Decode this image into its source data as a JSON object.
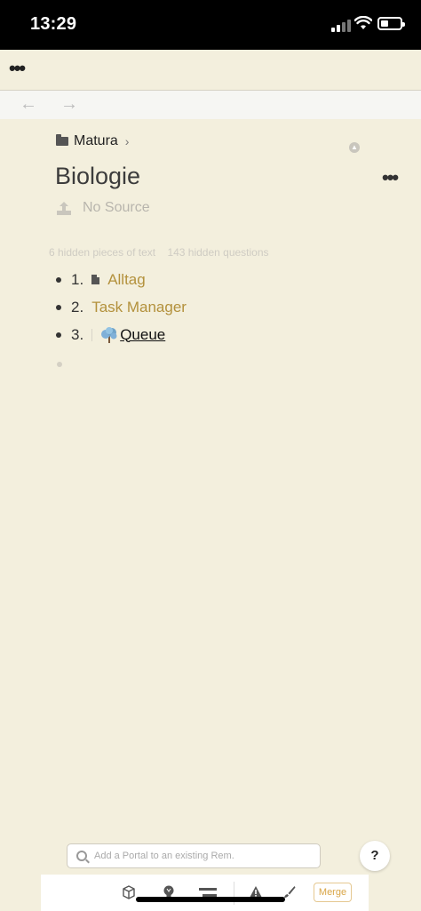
{
  "status_bar": {
    "time": "13:29"
  },
  "nav": {
    "back_label": "←",
    "forward_label": "→"
  },
  "breadcrumb": {
    "folder": "Matura",
    "chevron": "›"
  },
  "page": {
    "title": "Biologie",
    "source": "No Source"
  },
  "hidden_info": {
    "text_count": "6 hidden pieces of text",
    "question_count": "143 hidden questions"
  },
  "list": {
    "items": [
      {
        "number": "1.",
        "label": "Alltag",
        "icon": "document-icon"
      },
      {
        "number": "2.",
        "label": "Task Manager"
      },
      {
        "number": "3.",
        "label": "Queue",
        "icon": "tree-icon"
      }
    ]
  },
  "portal": {
    "placeholder": "Add a Portal to an existing Rem."
  },
  "help": {
    "label": "?"
  },
  "bottom_bar": {
    "merge_label": "Merge"
  },
  "colors": {
    "background": "#f3efdd",
    "link": "#b3913c",
    "merge_accent": "#d9a648"
  }
}
